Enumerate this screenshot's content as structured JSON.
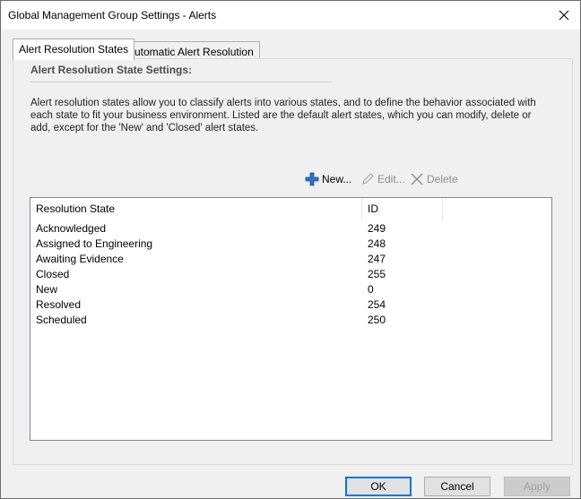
{
  "window": {
    "title": "Global Management Group Settings - Alerts"
  },
  "tabs": [
    {
      "label": "Alert Resolution States",
      "active": true
    },
    {
      "label": "Automatic Alert Resolution",
      "active": false
    }
  ],
  "section": {
    "title": "Alert Resolution State Settings:",
    "description": "Alert resolution states allow you to classify alerts into various states, and to define the behavior associated with each state to fit your business environment. Listed are the default alert states, which you can modify, delete or add, except for the 'New' and 'Closed' alert states."
  },
  "toolbar": {
    "new_label": "New...",
    "edit_label": "Edit...",
    "delete_label": "Delete"
  },
  "list": {
    "columns": [
      "Resolution State",
      "ID"
    ],
    "rows": [
      {
        "state": "Acknowledged",
        "id": "249"
      },
      {
        "state": "Assigned to Engineering",
        "id": "248"
      },
      {
        "state": "Awaiting Evidence",
        "id": "247"
      },
      {
        "state": "Closed",
        "id": "255"
      },
      {
        "state": "New",
        "id": "0"
      },
      {
        "state": "Resolved",
        "id": "254"
      },
      {
        "state": "Scheduled",
        "id": "250"
      }
    ]
  },
  "buttons": {
    "ok": "OK",
    "cancel": "Cancel",
    "apply": "Apply"
  },
  "colors": {
    "accent": "#0078d7",
    "add_icon": "#2e74c9"
  }
}
